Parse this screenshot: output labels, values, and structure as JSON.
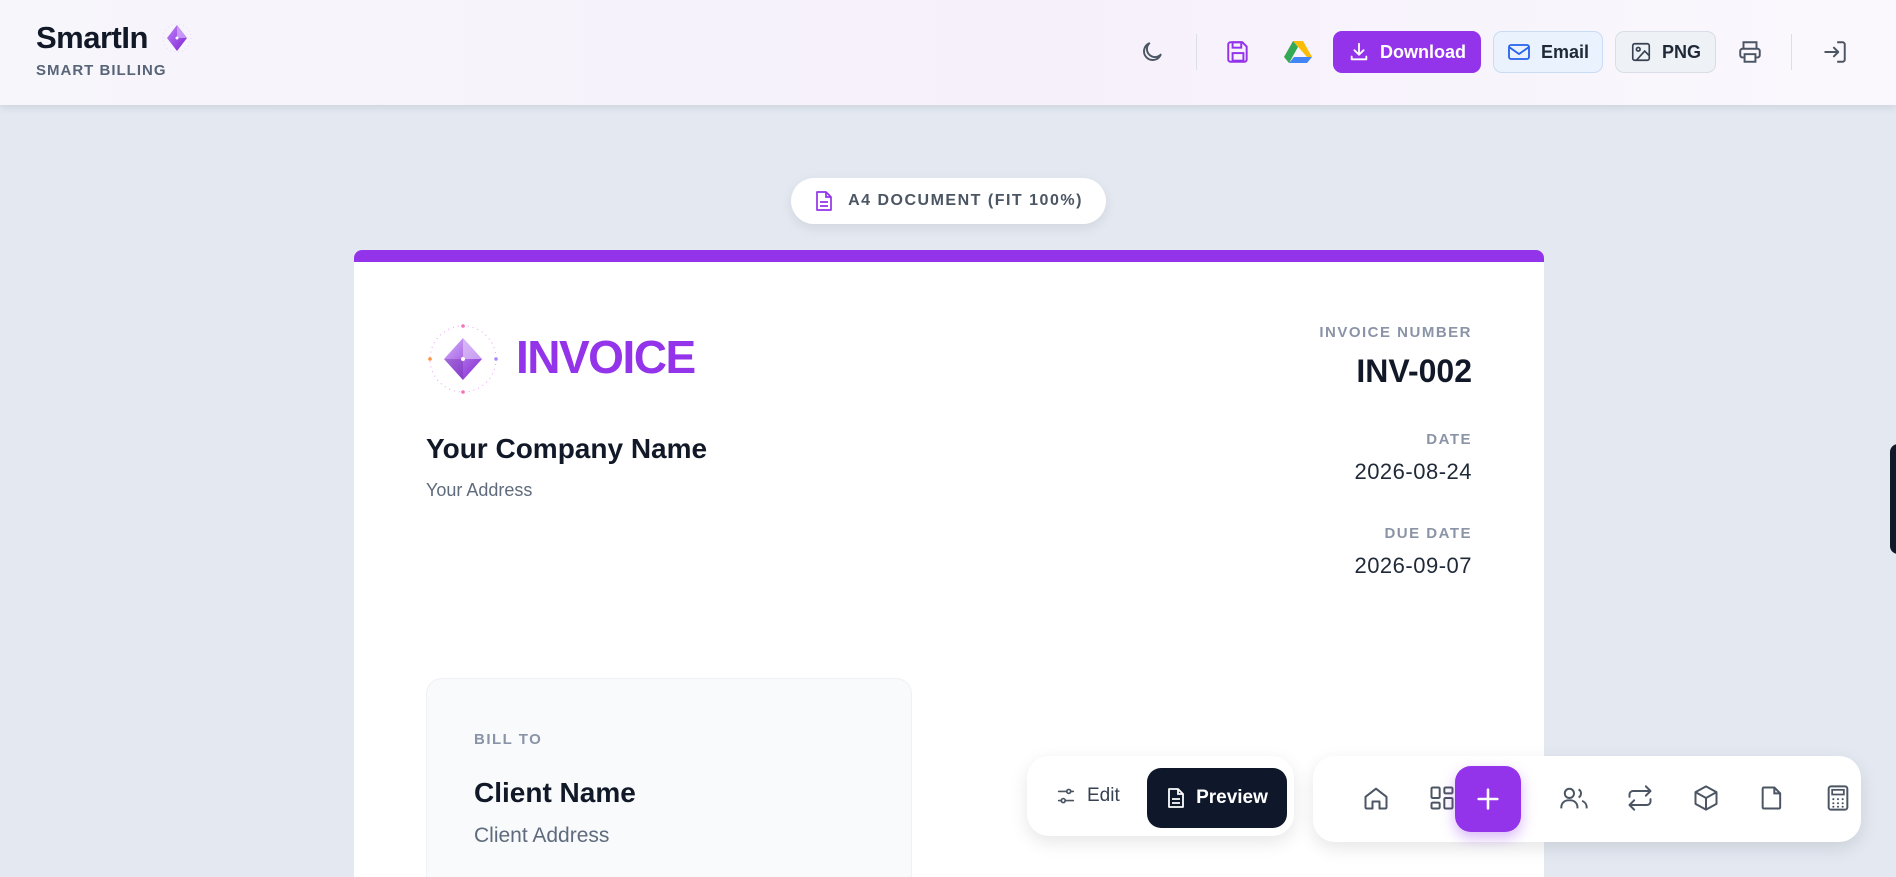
{
  "header": {
    "brand_name": "SmartIn",
    "brand_sub": "SMART BILLING",
    "download_label": "Download",
    "email_label": "Email",
    "png_label": "PNG"
  },
  "doc_badge": {
    "label": "A4 DOCUMENT (FIT 100%)"
  },
  "invoice": {
    "title": "INVOICE",
    "company_name": "Your Company Name",
    "company_address": "Your Address",
    "number_label": "INVOICE NUMBER",
    "number": "INV-002",
    "date_label": "DATE",
    "date": "2026-08-24",
    "due_date_label": "DUE DATE",
    "due_date": "2026-09-07",
    "bill_to_label": "BILL TO",
    "client_name": "Client Name",
    "client_address": "Client Address"
  },
  "mode_bar": {
    "edit_label": "Edit",
    "preview_label": "Preview"
  },
  "icons": {
    "theme": "moon-icon",
    "save": "save-icon",
    "drive": "google-drive-icon",
    "download": "download-icon",
    "email": "mail-icon",
    "png": "image-icon",
    "print": "printer-icon",
    "logout": "logout-icon",
    "home": "home-icon",
    "dashboard": "grid-icon",
    "add": "plus-icon",
    "clients": "users-icon",
    "transactions": "repeat-icon",
    "products": "box-icon",
    "documents": "file-icon",
    "calculator": "calculator-icon"
  },
  "colors": {
    "accent": "#9333ea",
    "dark": "#0f172a",
    "background": "#e3e8f1"
  }
}
